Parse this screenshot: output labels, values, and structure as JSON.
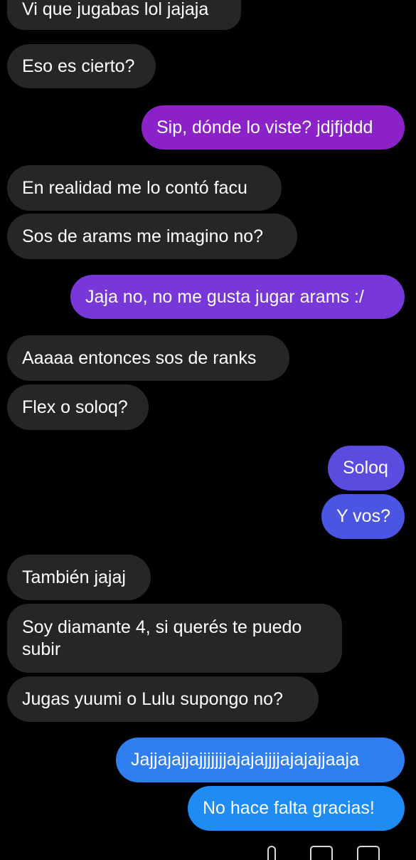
{
  "messages": [
    {
      "side": "received",
      "text": "Vi que jugabas lol jajaja"
    },
    {
      "side": "received",
      "text": "Eso es cierto?"
    },
    {
      "side": "sent",
      "text": "Sip, dónde lo viste? jdjfjddd",
      "color": "#8b21c9"
    },
    {
      "side": "received",
      "text": "En realidad me lo contó facu"
    },
    {
      "side": "received",
      "text": "Sos de arams me imagino no?"
    },
    {
      "side": "sent",
      "text": "Jaja no, no me gusta jugar arams :/",
      "color": "#7737d9"
    },
    {
      "side": "received",
      "text": "Aaaaa entonces sos de ranks"
    },
    {
      "side": "received",
      "text": "Flex o soloq?"
    },
    {
      "side": "sent",
      "text": "Soloq",
      "color": "#5b4ce0"
    },
    {
      "side": "sent",
      "text": "Y vos?",
      "color": "#4a55e2"
    },
    {
      "side": "received",
      "text": "También jajaj"
    },
    {
      "side": "received",
      "text": "Soy diamante 4, si querés te puedo subir"
    },
    {
      "side": "received",
      "text": "Jugas yuumi o Lulu supongo no?"
    },
    {
      "side": "sent",
      "text": "Jajjajajjajjjjjjjajajajjjjajajajjaaja",
      "color": "#2f7ff0"
    },
    {
      "side": "sent",
      "text": "No hace falta gracias!",
      "color": "#1f8bf5"
    }
  ],
  "bottom_icons": [
    "paperclip-icon",
    "gallery-icon",
    "sticker-icon"
  ]
}
